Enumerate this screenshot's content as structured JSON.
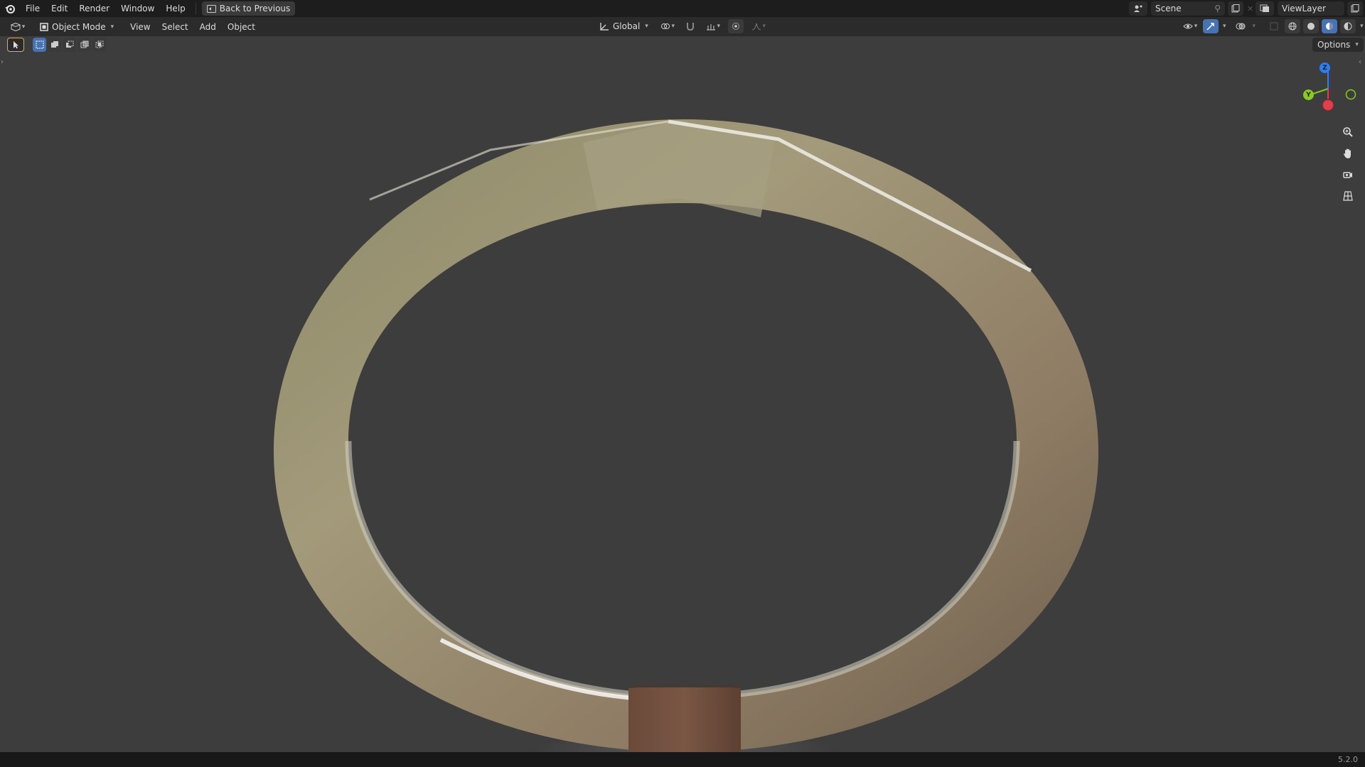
{
  "topbar": {
    "menu": [
      "File",
      "Edit",
      "Render",
      "Window",
      "Help"
    ],
    "back_button": "Back to Previous",
    "scene": "Scene",
    "view_layer": "ViewLayer"
  },
  "header": {
    "mode": "Object Mode",
    "menus": [
      "View",
      "Select",
      "Add",
      "Object"
    ],
    "transform_orientation": "Global"
  },
  "viewport": {
    "options_label": "Options",
    "gizmo_axes": {
      "z": "Z",
      "y": "Y"
    }
  },
  "status": {
    "version": "5.2.0"
  },
  "colors": {
    "accent": "#4772b3",
    "axis_x": "#e0404b",
    "axis_y": "#8ac926",
    "axis_z": "#2f7df0"
  }
}
